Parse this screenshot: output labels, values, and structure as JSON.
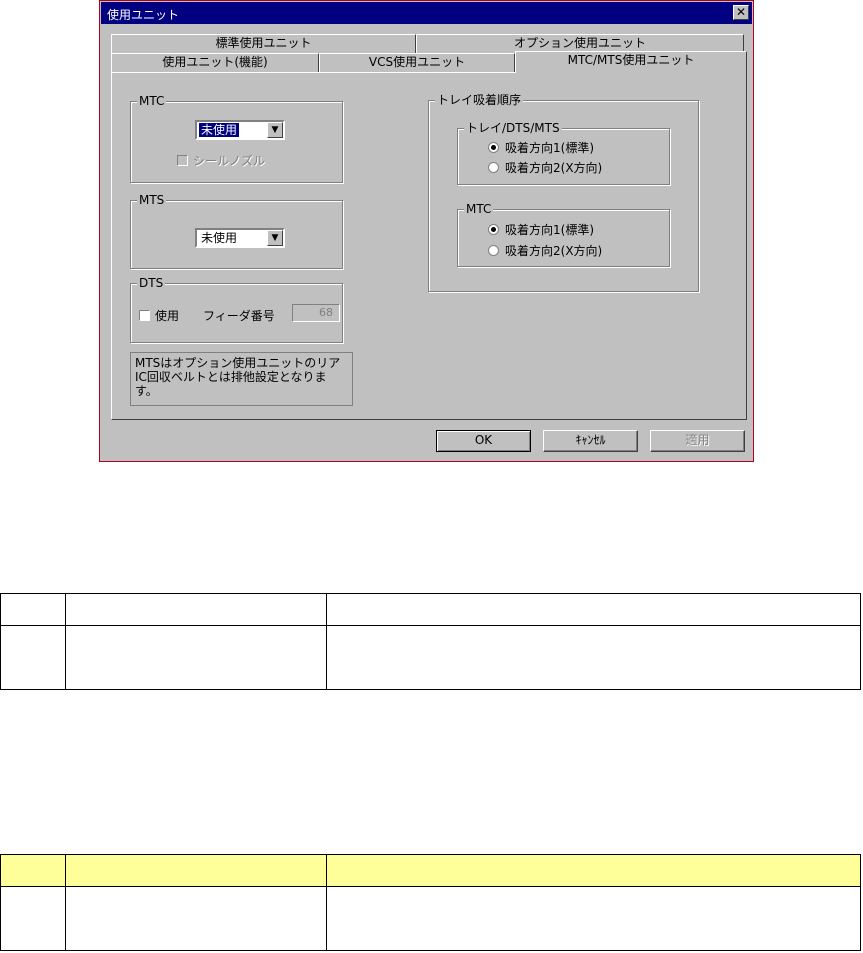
{
  "dialog": {
    "title": "使用ユニット",
    "close_glyph": "✕",
    "tabs_back": [
      "標準使用ユニット",
      "オプション使用ユニット"
    ],
    "tabs_front": [
      "使用ユニット(機能)",
      "VCS使用ユニット",
      "MTC/MTS使用ユニット"
    ],
    "mtc": {
      "label": "MTC",
      "value": "未使用",
      "seal_nozzle": "シールノズル"
    },
    "mts": {
      "label": "MTS",
      "value": "未使用"
    },
    "dts": {
      "label": "DTS",
      "use_label": "使用",
      "feeder_label": "フィーダ番号",
      "feeder_value": "68"
    },
    "note": "MTSはオプション使用ユニットのリアIC回収ベルトとは排他設定となります。",
    "tray": {
      "label": "トレイ吸着順序",
      "group1": {
        "label": "トレイ/DTS/MTS",
        "option1": "吸着方向1(標準)",
        "option2": "吸着方向2(X方向)",
        "selected": 1
      },
      "group2": {
        "label": "MTC",
        "option1": "吸着方向1(標準)",
        "option2": "吸着方向2(X方向)",
        "selected": 1
      }
    },
    "buttons": {
      "ok": "OK",
      "cancel": "ｷｬﾝｾﾙ",
      "apply": "適用"
    }
  },
  "colors": {
    "title_bar": "#000080",
    "face": "#c0c0c0",
    "header_yellow": "#ffff99",
    "window_border": "#b00020"
  }
}
